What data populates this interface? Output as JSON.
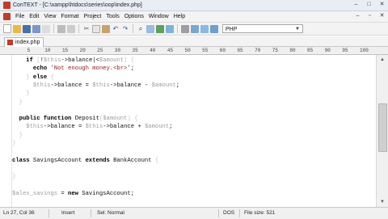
{
  "window": {
    "title": "ConTEXT - [C:\\xampp\\htdocs\\series\\oop\\index.php]",
    "controls": [
      "–",
      "□",
      "✕"
    ]
  },
  "menu": {
    "items": [
      "File",
      "Edit",
      "View",
      "Format",
      "Project",
      "Tools",
      "Options",
      "Window",
      "Help"
    ],
    "mdi_controls": [
      "–",
      "▫",
      "✕"
    ]
  },
  "toolbar": {
    "language": "PHP"
  },
  "tab": {
    "label": "index.php"
  },
  "ruler": {
    "labels": [
      "5",
      "10",
      "15",
      "20",
      "25",
      "30",
      "35",
      "40",
      "45",
      "50",
      "55",
      "60",
      "65",
      "70",
      "75",
      "80",
      "85",
      "90",
      "95",
      "100"
    ]
  },
  "code": {
    "lines": [
      "    if (!$this->balance|<$amount) {",
      "      echo 'Not enough money.<br>';",
      "    } else {",
      "      $this->balance = $this->balance - $amount;",
      "    }",
      "  }",
      "",
      "  public function Deposit($amount) {",
      "    $this->balance = $this->balance + $amount;",
      "  }",
      "}",
      "",
      "class SavingsAccount extends BankAccount {",
      "",
      "}",
      "",
      "$alex_savings = new SavingsAccount;",
      ""
    ]
  },
  "status": {
    "position": "Ln 27, Col 36",
    "mode": "Insert",
    "selection": "Sel: Normal",
    "format": "DOS",
    "file_size": "File size: 521"
  }
}
